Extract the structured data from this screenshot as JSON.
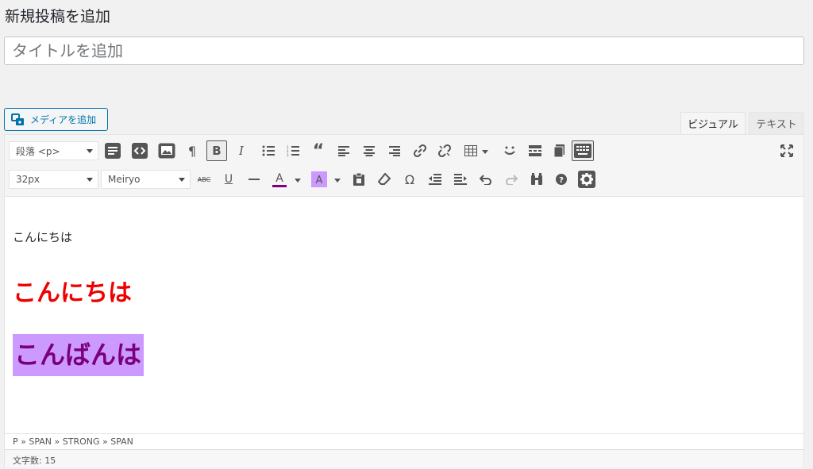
{
  "header": {
    "title": "新規投稿を追加"
  },
  "title_field": {
    "placeholder": "タイトルを追加",
    "value": ""
  },
  "media_button": {
    "label": "メディアを追加"
  },
  "tabs": [
    {
      "label": "ビジュアル",
      "active": true
    },
    {
      "label": "テキスト",
      "active": false
    }
  ],
  "toolbar": {
    "format_select": "段落 <p>",
    "font_size_select": "32px",
    "font_family_select": "Meiryo",
    "icons_row1": [
      "toggle-toolbar-icon",
      "code-icon",
      "insert-image-icon",
      "paragraph-mark-icon",
      "bold-icon",
      "italic-icon",
      "bullet-list-icon",
      "numbered-list-icon",
      "blockquote-icon",
      "align-left-icon",
      "align-center-icon",
      "align-right-icon",
      "link-icon",
      "unlink-icon",
      "table-icon",
      "emoticon-icon",
      "read-more-icon",
      "page-break-icon",
      "keyboard-icon",
      "fullscreen-icon"
    ],
    "icons_row2": [
      "strikethrough-icon",
      "underline-icon",
      "horizontal-rule-icon",
      "text-color-icon",
      "background-color-icon",
      "paste-text-icon",
      "clear-format-icon",
      "special-char-icon",
      "outdent-icon",
      "indent-icon",
      "undo-icon",
      "redo-icon",
      "find-replace-icon",
      "help-icon",
      "settings-icon"
    ],
    "text_color": "#800080",
    "bg_color": "#cc99ff"
  },
  "content": {
    "line1": "こんにちは",
    "line2": "こんにちは",
    "line3": "こんばんは",
    "line2_color": "#e00000",
    "line3_color": "#7a007a",
    "line3_bg": "#cc99ff"
  },
  "element_path": "P » SPAN » STRONG » SPAN",
  "word_count": "文字数: 15"
}
